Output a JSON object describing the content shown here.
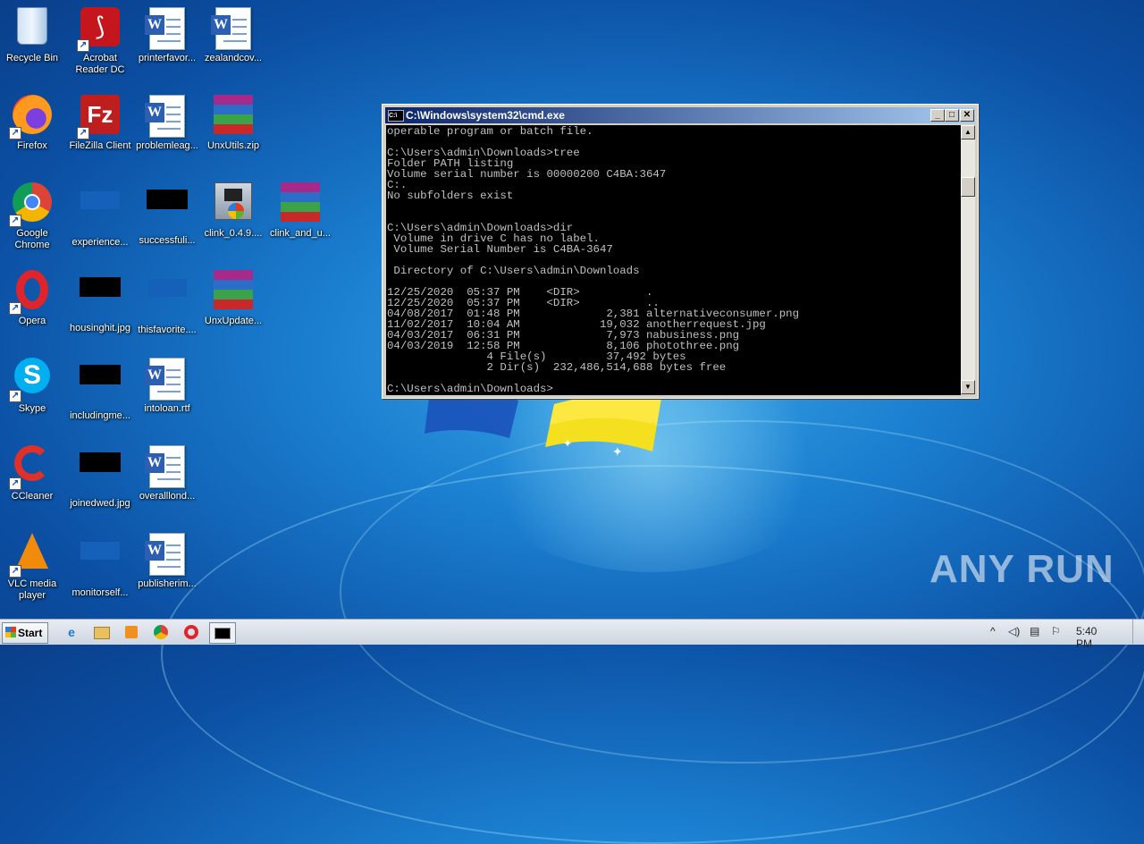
{
  "desktop": {
    "icons": [
      {
        "label": "Recycle Bin"
      },
      {
        "label": "Acrobat Reader DC"
      },
      {
        "label": "printerfavor..."
      },
      {
        "label": "zealandcov..."
      },
      {
        "label": "Firefox"
      },
      {
        "label": "FileZilla Client"
      },
      {
        "label": "problemleag..."
      },
      {
        "label": "UnxUtils.zip"
      },
      {
        "label": "Google Chrome"
      },
      {
        "label": "experience..."
      },
      {
        "label": "successfuli..."
      },
      {
        "label": "clink_0.4.9...."
      },
      {
        "label": "clink_and_u..."
      },
      {
        "label": "Opera"
      },
      {
        "label": "housinghit.jpg"
      },
      {
        "label": "thisfavorite...."
      },
      {
        "label": "UnxUpdate..."
      },
      {
        "label": "Skype"
      },
      {
        "label": "includingme..."
      },
      {
        "label": "intoloan.rtf"
      },
      {
        "label": "CCleaner"
      },
      {
        "label": "joinedwed.jpg"
      },
      {
        "label": "overalllond..."
      },
      {
        "label": "VLC media player"
      },
      {
        "label": "monitorself..."
      },
      {
        "label": "publisherim..."
      }
    ]
  },
  "cmd_window": {
    "title": "C:\\Windows\\system32\\cmd.exe",
    "lines": [
      "operable program or batch file.",
      "",
      "C:\\Users\\admin\\Downloads>tree",
      "Folder PATH listing",
      "Volume serial number is 00000200 C4BA:3647",
      "C:.",
      "No subfolders exist",
      "",
      "",
      "C:\\Users\\admin\\Downloads>dir",
      " Volume in drive C has no label.",
      " Volume Serial Number is C4BA-3647",
      "",
      " Directory of C:\\Users\\admin\\Downloads",
      "",
      "12/25/2020  05:37 PM    <DIR>          .",
      "12/25/2020  05:37 PM    <DIR>          ..",
      "04/08/2017  01:48 PM             2,381 alternativeconsumer.png",
      "11/02/2017  10:04 AM            19,032 anotherrequest.jpg",
      "04/03/2017  06:31 PM             7,973 nabusiness.png",
      "04/03/2019  12:58 PM             8,106 photothree.png",
      "               4 File(s)         37,492 bytes",
      "               2 Dir(s)  232,486,514,688 bytes free",
      "",
      "C:\\Users\\admin\\Downloads>"
    ]
  },
  "taskbar": {
    "start_label": "Start",
    "clock": "5:40 PM"
  },
  "watermark": "ANY RUN"
}
